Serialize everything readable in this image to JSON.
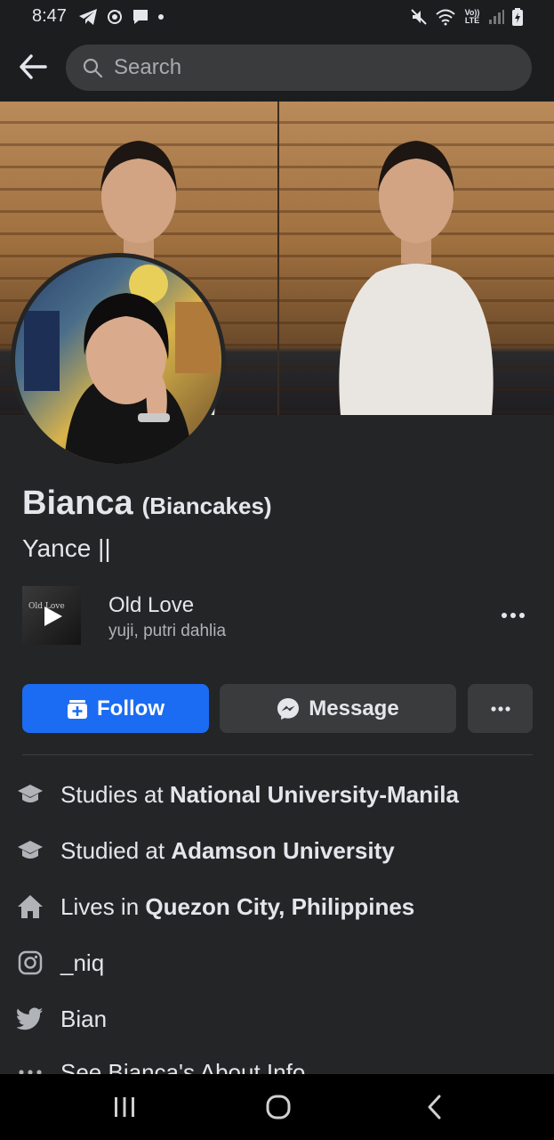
{
  "status_bar": {
    "time": "8:47",
    "network_label": "Vo)) LTE"
  },
  "search": {
    "placeholder": "Search"
  },
  "profile": {
    "name": "Bianca",
    "alternate_name": "(Biancakes)",
    "bio": "Yance ||"
  },
  "music": {
    "thumb_label": "Old Love",
    "title": "Old Love",
    "artist": "yuji, putri dahlia"
  },
  "actions": {
    "follow_label": "Follow",
    "message_label": "Message"
  },
  "about": [
    {
      "icon": "graduation-cap-icon",
      "prefix": "Studies at ",
      "value": "National University-Manila"
    },
    {
      "icon": "graduation-cap-icon",
      "prefix": "Studied at ",
      "value": "Adamson University"
    },
    {
      "icon": "home-icon",
      "prefix": "Lives in ",
      "value": "Quezon City, Philippines"
    },
    {
      "icon": "instagram-icon",
      "prefix": "",
      "value": "_niq"
    },
    {
      "icon": "twitter-icon",
      "prefix": "",
      "value": "Bian"
    },
    {
      "icon": "more-dots-icon",
      "prefix": "",
      "value": "See Bianca's About Info"
    }
  ],
  "colors": {
    "background": "#242526",
    "follow_button": "#1b6cf2",
    "secondary_button": "#3a3b3c",
    "text_primary": "#e4e6eb",
    "text_secondary": "#b0b3b8"
  }
}
